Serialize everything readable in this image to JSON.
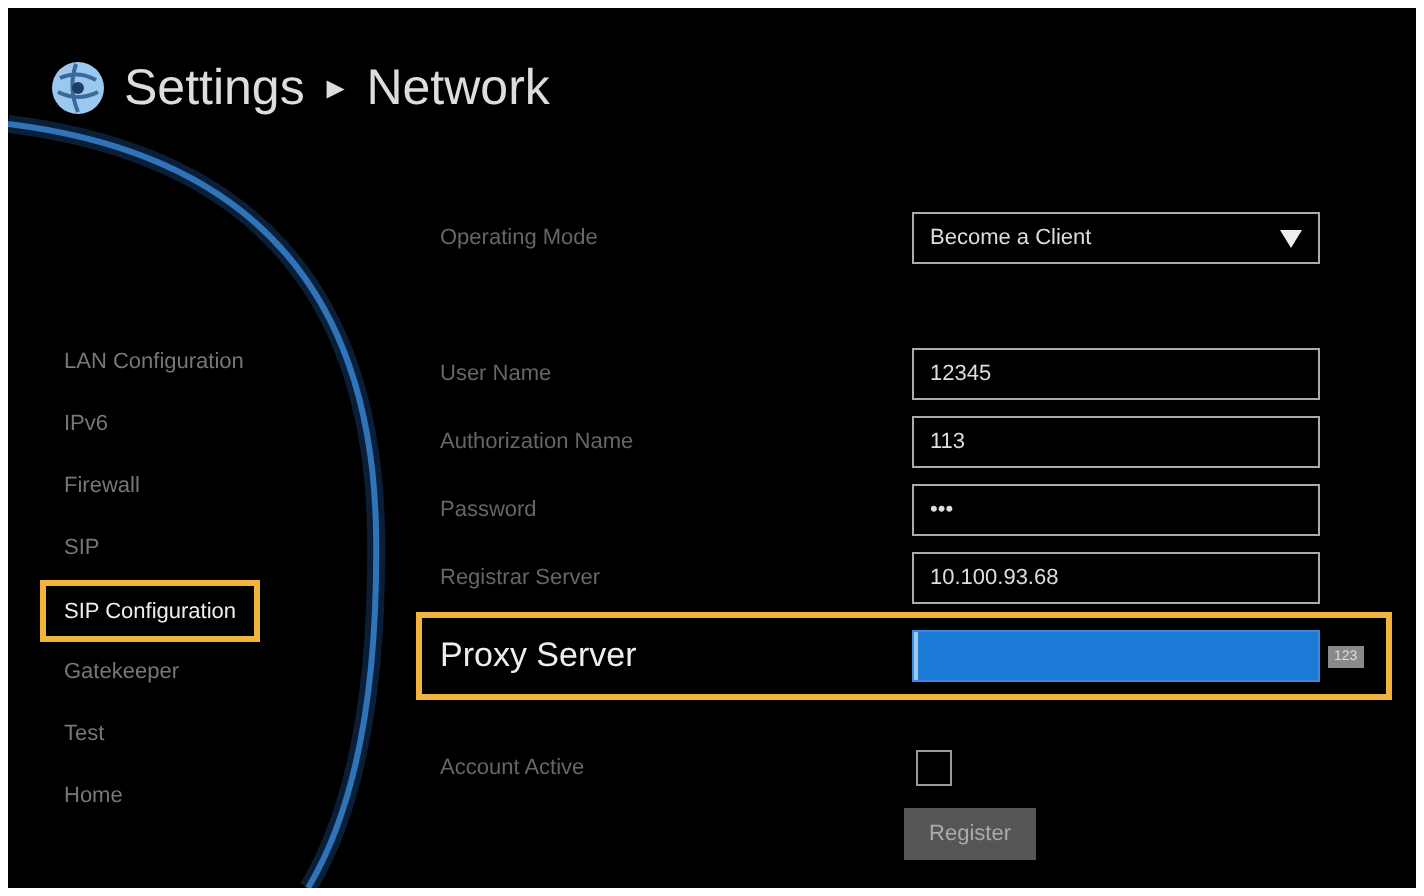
{
  "header": {
    "title": "Settings",
    "separator": "►",
    "subtitle": "Network"
  },
  "sidebar": {
    "items": [
      {
        "label": "LAN Configuration",
        "selected": false
      },
      {
        "label": "IPv6",
        "selected": false
      },
      {
        "label": "Firewall",
        "selected": false
      },
      {
        "label": "SIP",
        "selected": false
      },
      {
        "label": "SIP Configuration",
        "selected": true
      },
      {
        "label": "Gatekeeper",
        "selected": false
      },
      {
        "label": "Test",
        "selected": false
      },
      {
        "label": "Home",
        "selected": false
      }
    ]
  },
  "form": {
    "rows": [
      {
        "kind": "select",
        "label": "Operating Mode",
        "value": "Become a Client",
        "selected": false
      },
      {
        "kind": "text",
        "label": "User Name",
        "value": "12345",
        "selected": false
      },
      {
        "kind": "text",
        "label": "Authorization Name",
        "value": "113",
        "selected": false
      },
      {
        "kind": "text",
        "label": "Password",
        "value": "•••",
        "selected": false
      },
      {
        "kind": "text",
        "label": "Registrar Server",
        "value": "10.100.93.68",
        "selected": false
      },
      {
        "kind": "text",
        "label": "Proxy Server",
        "value": "",
        "selected": true,
        "badge": "123"
      },
      {
        "kind": "checkbox",
        "label": "Account Active",
        "checked": false,
        "selected": false
      }
    ],
    "button": "Register"
  }
}
